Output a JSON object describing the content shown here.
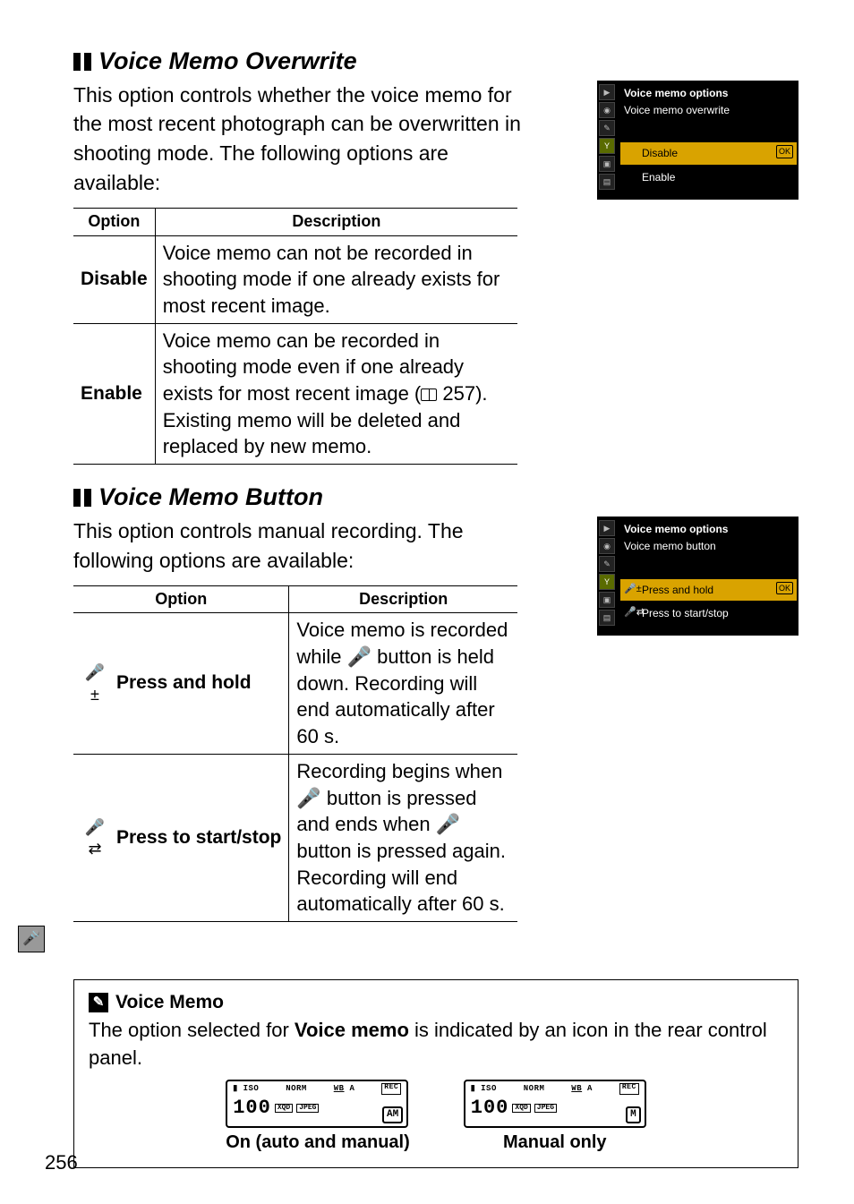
{
  "section1": {
    "title": "Voice Memo Overwrite",
    "body": "This option controls whether the voice memo for the most recent photograph can be overwritten in shooting mode.  The following options are available:"
  },
  "table1": {
    "head_option": "Option",
    "head_desc": "Description",
    "rows": [
      {
        "option": "Disable",
        "desc": "Voice memo can not be recorded in shooting mode if one already exists for most recent image."
      },
      {
        "option": "Enable",
        "desc_pre": "Voice memo can be recorded in shooting mode even if one already exists for most recent image (",
        "desc_ref": " 257",
        "desc_post": "). Existing memo will be deleted and replaced by new memo."
      }
    ]
  },
  "screenshot1": {
    "title": "Voice memo options",
    "subtitle": "Voice memo overwrite",
    "items": [
      {
        "label": "Disable",
        "selected": true
      },
      {
        "label": "Enable",
        "selected": false
      }
    ]
  },
  "section2": {
    "title": "Voice Memo Button",
    "body": "This option controls manual recording.  The following options are available:"
  },
  "table2": {
    "head_option": "Option",
    "head_desc": "Description",
    "rows": [
      {
        "icon": "🎤±",
        "option": "Press and hold",
        "desc_pre": "Voice memo is recorded while ",
        "desc_mid": " button is held down.  Recording will end automatically after 60 s."
      },
      {
        "icon": "🎤⇄",
        "option": "Press to start/​stop",
        "desc_pre": "Recording begins when ",
        "desc_mid": " button is pressed and ends when ",
        "desc_post": " button is pressed again. Recording will end automatically after 60 s."
      }
    ]
  },
  "screenshot2": {
    "title": "Voice memo options",
    "subtitle": "Voice memo button",
    "items": [
      {
        "label": "Press and hold",
        "glyph": "🎤±",
        "selected": true
      },
      {
        "label": "Press to start/stop",
        "glyph": "🎤⇄",
        "selected": false
      }
    ]
  },
  "note": {
    "title": "Voice Memo",
    "body_pre": "The option selected for ",
    "body_bold": "Voice memo",
    "body_post": " is indicated by an icon in the rear control panel.",
    "lcd": {
      "common": {
        "iso": "ISO",
        "norm": "NORM",
        "wb": "WB",
        "a": "A",
        "rec": "REC",
        "xqd": "XQD",
        "jpeg": "JPEG",
        "digits": "100"
      },
      "left": {
        "mode": "AM",
        "caption": "On (auto and manual)"
      },
      "right": {
        "mode": "M",
        "caption": "Manual only"
      }
    }
  },
  "page_number": "256",
  "icons": {
    "mic": "🎤"
  }
}
